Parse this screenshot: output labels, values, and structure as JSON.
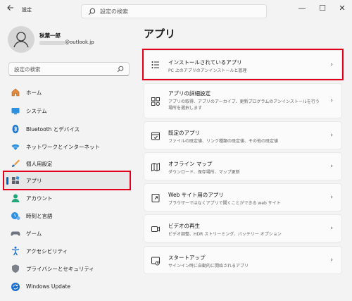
{
  "window": {
    "title": "設定",
    "search_placeholder": "設定の検索",
    "controls": {
      "minimize": "—",
      "maximize": "☐",
      "close": "✕"
    }
  },
  "profile": {
    "name": "秋葉一郎",
    "email_suffix": "@outlook.jp"
  },
  "sidebar": {
    "search_placeholder": "設定の検索",
    "items": [
      {
        "label": "ホーム",
        "icon": "home-icon"
      },
      {
        "label": "システム",
        "icon": "system-icon"
      },
      {
        "label": "Bluetooth とデバイス",
        "icon": "bluetooth-icon"
      },
      {
        "label": "ネットワークとインターネット",
        "icon": "network-icon"
      },
      {
        "label": "個人用設定",
        "icon": "personalization-icon"
      },
      {
        "label": "アプリ",
        "icon": "apps-icon",
        "selected": true
      },
      {
        "label": "アカウント",
        "icon": "account-icon"
      },
      {
        "label": "時刻と言語",
        "icon": "time-language-icon"
      },
      {
        "label": "ゲーム",
        "icon": "gaming-icon"
      },
      {
        "label": "アクセシビリティ",
        "icon": "accessibility-icon"
      },
      {
        "label": "プライバシーとセキュリティ",
        "icon": "privacy-icon"
      },
      {
        "label": "Windows Update",
        "icon": "windows-update-icon"
      }
    ]
  },
  "main": {
    "title": "アプリ",
    "cards": [
      {
        "title": "インストールされているアプリ",
        "desc": "PC 上のアプリのアンインストールと管理",
        "icon": "installed-apps-icon"
      },
      {
        "title": "アプリの詳細設定",
        "desc": "アプリの取得、アプリのアーカイブ、更新プログラムのアンインストールを行う場所を選択します",
        "icon": "advanced-app-settings-icon"
      },
      {
        "title": "既定のアプリ",
        "desc": "ファイルの既定値、リンク種類の既定値、その他の既定値",
        "icon": "default-apps-icon"
      },
      {
        "title": "オフライン マップ",
        "desc": "ダウンロード、保存場所、マップ更新",
        "icon": "offline-maps-icon"
      },
      {
        "title": "Web サイト用のアプリ",
        "desc": "ブラウザーではなくアプリで開くことができる web サイト",
        "icon": "apps-for-websites-icon"
      },
      {
        "title": "ビデオの再生",
        "desc": "ビデオ調整、HDR ストリーミング、バッテリー オプション",
        "icon": "video-playback-icon"
      },
      {
        "title": "スタートアップ",
        "desc": "サインイン時に自動的に開始されるアプリ",
        "icon": "startup-icon"
      }
    ]
  },
  "colors": {
    "accent": "#0067c0",
    "highlight": "#e3001b"
  }
}
